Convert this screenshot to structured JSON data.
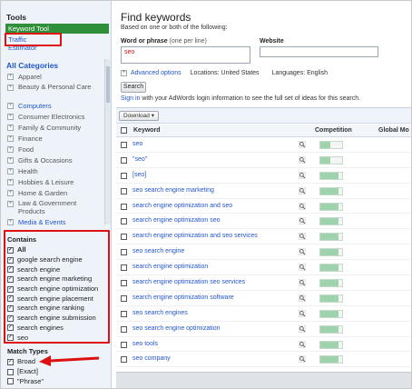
{
  "sidebar": {
    "title": "Tools",
    "tools": [
      {
        "label": "Keyword Tool",
        "active": true
      },
      {
        "label": "Traffic Estimator",
        "active": false
      }
    ],
    "categories_title": "All Categories",
    "categories": [
      {
        "label": "Apparel",
        "link": false
      },
      {
        "label": "Beauty & Personal Care",
        "link": false
      },
      {
        "label": "Computers",
        "link": true
      },
      {
        "label": "Consumer Electronics",
        "link": false
      },
      {
        "label": "Family & Community",
        "link": false
      },
      {
        "label": "Finance",
        "link": false
      },
      {
        "label": "Food",
        "link": false
      },
      {
        "label": "Gifts & Occasions",
        "link": false
      },
      {
        "label": "Health",
        "link": false
      },
      {
        "label": "Hobbies & Leisure",
        "link": false
      },
      {
        "label": "Home & Garden",
        "link": false
      },
      {
        "label": "Law & Government Products",
        "link": false
      },
      {
        "label": "Media & Events",
        "link": true
      }
    ],
    "contains_title": "Contains",
    "contains": [
      {
        "label": "All",
        "bold": true
      },
      {
        "label": "google search engine",
        "bold": false
      },
      {
        "label": "search engine",
        "bold": false
      },
      {
        "label": "search engine marketing",
        "bold": false
      },
      {
        "label": "search engine optimization",
        "bold": false
      },
      {
        "label": "search engine placement",
        "bold": false
      },
      {
        "label": "search engine ranking",
        "bold": false
      },
      {
        "label": "search engine submission",
        "bold": false
      },
      {
        "label": "search engines",
        "bold": false
      },
      {
        "label": "seo",
        "bold": false
      }
    ],
    "match_title": "Match Types",
    "match_types": [
      {
        "label": "Broad",
        "checked": true
      },
      {
        "label": "[Exact]",
        "checked": false
      },
      {
        "label": "\"Phrase\"",
        "checked": false
      }
    ]
  },
  "main": {
    "title": "Find keywords",
    "subtitle": "Based on one or both of the following:",
    "word_label": "Word or phrase",
    "word_hint": "(one per line)",
    "word_value": "seo",
    "website_label": "Website",
    "advanced_label": "Advanced options",
    "locations": "Locations: United States",
    "languages": "Languages: English",
    "search_button": "Search",
    "signin_link": "Sign in",
    "signin_text": "with your AdWords login information to see the full set of ideas for this search.",
    "download_button": "Download ▾",
    "columns": {
      "keyword": "Keyword",
      "competition": "Competition",
      "global": "Global Mo"
    },
    "rows": [
      {
        "keyword": "seo",
        "competition": 0.45
      },
      {
        "keyword": "\"seo\"",
        "competition": 0.45
      },
      {
        "keyword": "[seo]",
        "competition": 0.85
      },
      {
        "keyword": "seo search engine marketing",
        "competition": 0.85
      },
      {
        "keyword": "search engine optimization and seo",
        "competition": 0.85
      },
      {
        "keyword": "search engine optimization seo",
        "competition": 0.85
      },
      {
        "keyword": "search engine optimization and seo services",
        "competition": 0.85
      },
      {
        "keyword": "seo search engine",
        "competition": 0.85
      },
      {
        "keyword": "search engine optimization",
        "competition": 0.85
      },
      {
        "keyword": "search engine optimization seo services",
        "competition": 0.85
      },
      {
        "keyword": "search engine optimization software",
        "competition": 0.85
      },
      {
        "keyword": "seo search engines",
        "competition": 0.85
      },
      {
        "keyword": "seo search engine optimization",
        "competition": 0.85
      },
      {
        "keyword": "seo tools",
        "competition": 0.85
      },
      {
        "keyword": "seo company",
        "competition": 0.85
      }
    ]
  },
  "colors": {
    "active_tool": "#2f8f3a",
    "link": "#2255cc",
    "annotation": "#dd1111",
    "competition_bar": "#9fd3ad"
  }
}
